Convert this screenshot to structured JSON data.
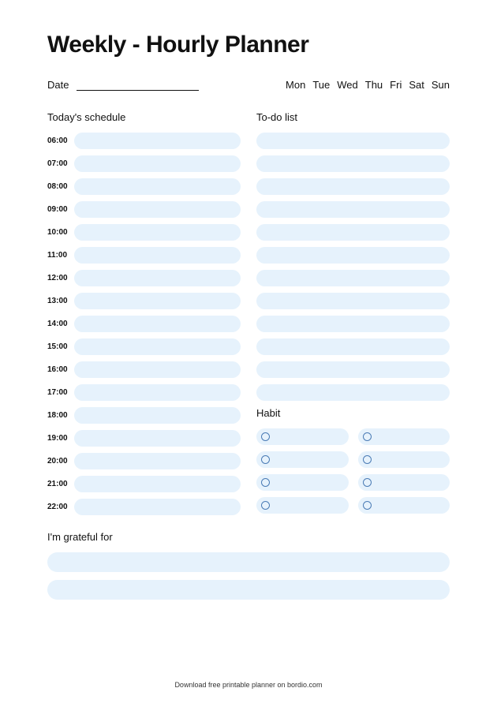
{
  "title": "Weekly - Hourly Planner",
  "dateLabel": "Date",
  "days": [
    "Mon",
    "Tue",
    "Wed",
    "Thu",
    "Fri",
    "Sat",
    "Sun"
  ],
  "scheduleLabel": "Today's schedule",
  "hours": [
    "06:00",
    "07:00",
    "08:00",
    "09:00",
    "10:00",
    "11:00",
    "12:00",
    "13:00",
    "14:00",
    "15:00",
    "16:00",
    "17:00",
    "18:00",
    "19:00",
    "20:00",
    "21:00",
    "22:00"
  ],
  "todoLabel": "To-do list",
  "todoCount": 12,
  "habitLabel": "Habit",
  "habitRows": 4,
  "gratefulLabel": "I'm grateful for",
  "gratefulCount": 2,
  "footer": "Download free printable planner on bordio.com"
}
